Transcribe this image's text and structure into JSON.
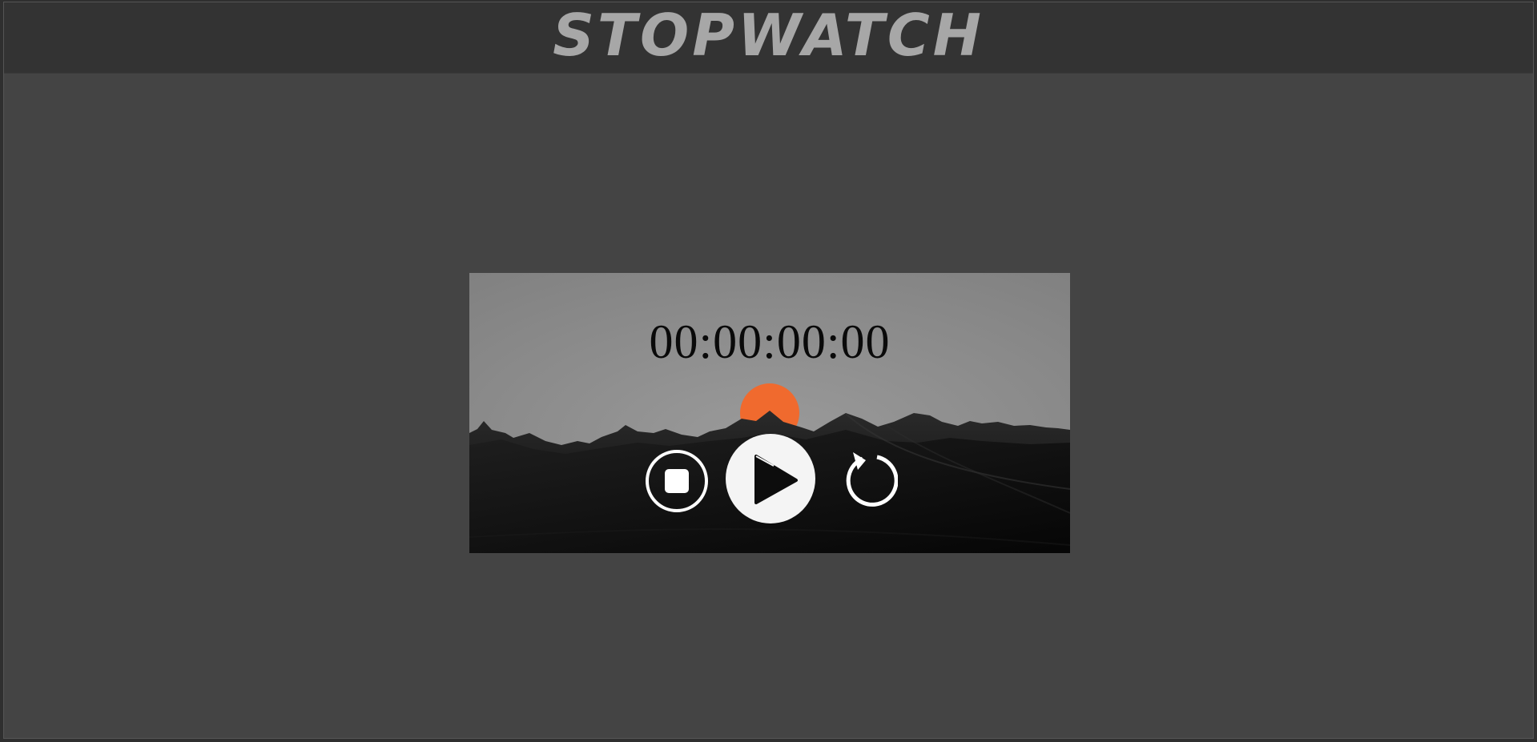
{
  "header": {
    "title": "STOPWATCH"
  },
  "stopwatch": {
    "time": "00:00:00:00"
  },
  "controls": {
    "stop_icon": "stop-circle-icon",
    "play_icon": "play-icon",
    "reset_icon": "reset-icon"
  },
  "colors": {
    "page_background": "#444444",
    "header_background": "#333333",
    "title_color": "#a7a7a7",
    "sun_accent": "#f06a2e"
  }
}
